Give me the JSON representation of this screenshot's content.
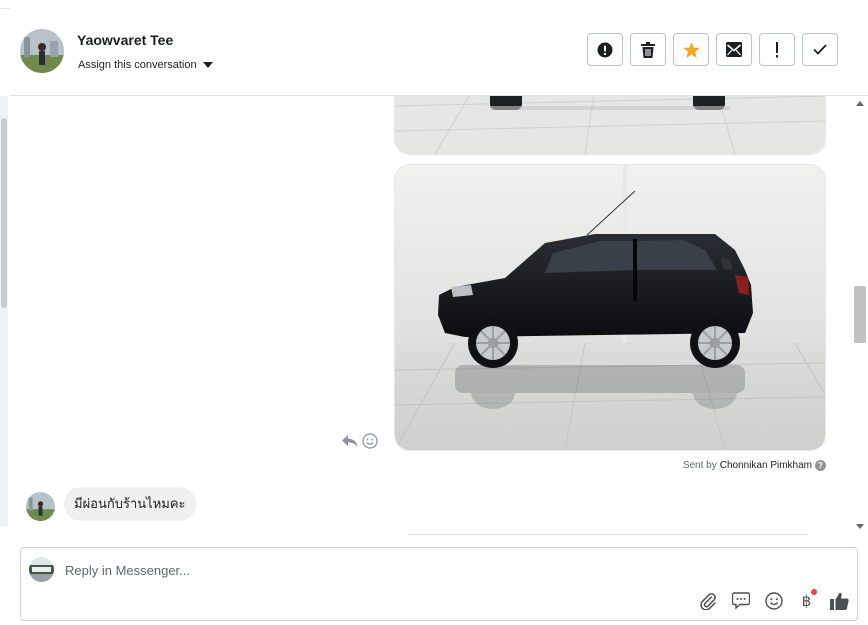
{
  "header": {
    "contact_name": "Yaowvaret Tee",
    "assign_label": "Assign this conversation"
  },
  "actions": [
    {
      "name": "spam",
      "icon": "exclamation-circle-icon"
    },
    {
      "name": "delete",
      "icon": "trash-icon"
    },
    {
      "name": "star",
      "icon": "star-icon",
      "color": "#f5a623"
    },
    {
      "name": "mark-unread",
      "icon": "envelope-icon"
    },
    {
      "name": "follow-up",
      "icon": "exclamation-icon"
    },
    {
      "name": "done",
      "icon": "check-icon"
    }
  ],
  "thread": {
    "sent_by_prefix": "Sent by",
    "sent_by_name": "Chonnikan Pimkham",
    "incoming_message": "มีผ่อนกับร้านไหมคะ"
  },
  "composer": {
    "placeholder": "Reply in Messenger...",
    "tools": [
      "paperclip-icon",
      "saved-reply-icon",
      "emoji-icon",
      "baht-payment-icon",
      "like-icon"
    ],
    "baht_symbol": "฿"
  },
  "colors": {
    "star": "#f5a623",
    "notification_dot": "#fa3e3e",
    "car_body": "#111418"
  }
}
